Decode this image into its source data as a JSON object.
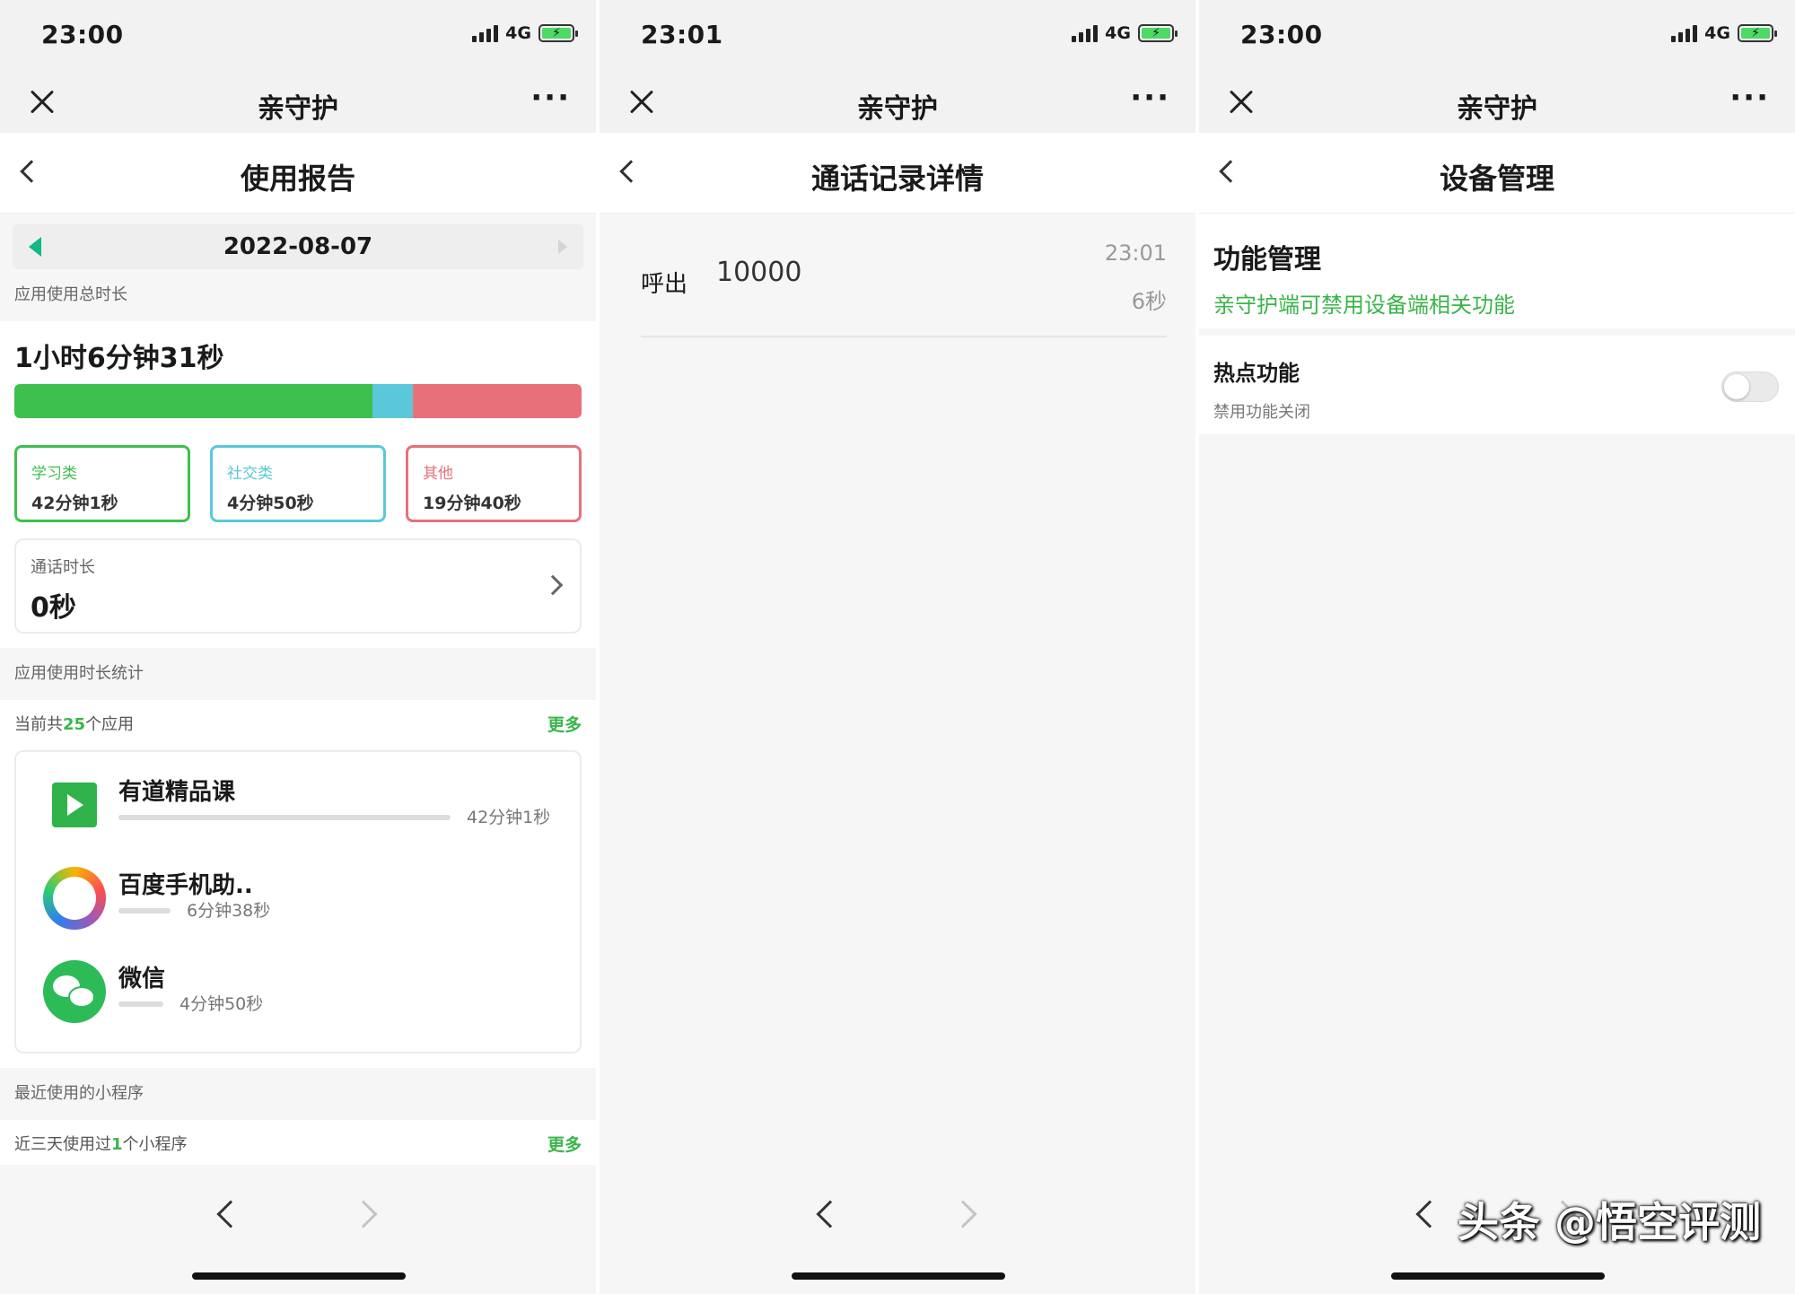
{
  "panels": [
    {
      "status": {
        "time": "23:00",
        "network": "4G"
      },
      "nav": {
        "title": "亲守护",
        "more": "···"
      },
      "page_title": "使用报告",
      "date": "2022-08-07",
      "total_label": "应用使用总时长",
      "total_time": "1小时6分钟31秒",
      "usage_bar": [
        {
          "name": "学习类",
          "fraction": 0.631,
          "color": "#3ec04e"
        },
        {
          "name": "社交类",
          "fraction": 0.072,
          "color": "#5ac8d8"
        },
        {
          "name": "其他",
          "fraction": 0.297,
          "color": "#e8707a"
        }
      ],
      "categories": [
        {
          "name": "学习类",
          "value": "42分钟1秒",
          "color": "#3ec04e"
        },
        {
          "name": "社交类",
          "value": "4分钟50秒",
          "color": "#5ac8d8"
        },
        {
          "name": "其他",
          "value": "19分钟40秒",
          "color": "#e8707a"
        }
      ],
      "call_label": "通话时长",
      "call_value": "0秒",
      "apps_section_label": "应用使用时长统计",
      "apps_count": {
        "prefix": "当前共",
        "count": "25",
        "suffix": "个应用",
        "more": "更多"
      },
      "apps": [
        {
          "name": "有道精品课",
          "duration": "42分钟1秒",
          "icon": "youdao-icon",
          "fraction": 1.0
        },
        {
          "name": "百度手机助..",
          "duration": "6分钟38秒",
          "icon": "baidu-icon",
          "fraction": 0.158
        },
        {
          "name": "微信",
          "duration": "4分钟50秒",
          "icon": "wechat-icon",
          "fraction": 0.115
        }
      ],
      "mini_section_label": "最近使用的小程序",
      "mini_count": {
        "prefix": "近三天使用过",
        "count": "1",
        "suffix": "个小程序",
        "more": "更多"
      }
    },
    {
      "status": {
        "time": "23:01",
        "network": "4G"
      },
      "nav": {
        "title": "亲守护",
        "more": "···"
      },
      "page_title": "通话记录详情",
      "call": {
        "direction": "呼出",
        "number": "10000",
        "time": "23:01",
        "duration": "6秒"
      }
    },
    {
      "status": {
        "time": "23:00",
        "network": "4G"
      },
      "nav": {
        "title": "亲守护",
        "more": "···"
      },
      "page_title": "设备管理",
      "func_title": "功能管理",
      "func_sub": "亲守护端可禁用设备端相关功能",
      "hotspot": {
        "title": "热点功能",
        "sub": "禁用功能关闭",
        "enabled": false
      }
    }
  ],
  "watermark": "头条 @悟空评测",
  "colors": {
    "accent_green": "#3ab54a",
    "date_arrow": "#12b886"
  }
}
